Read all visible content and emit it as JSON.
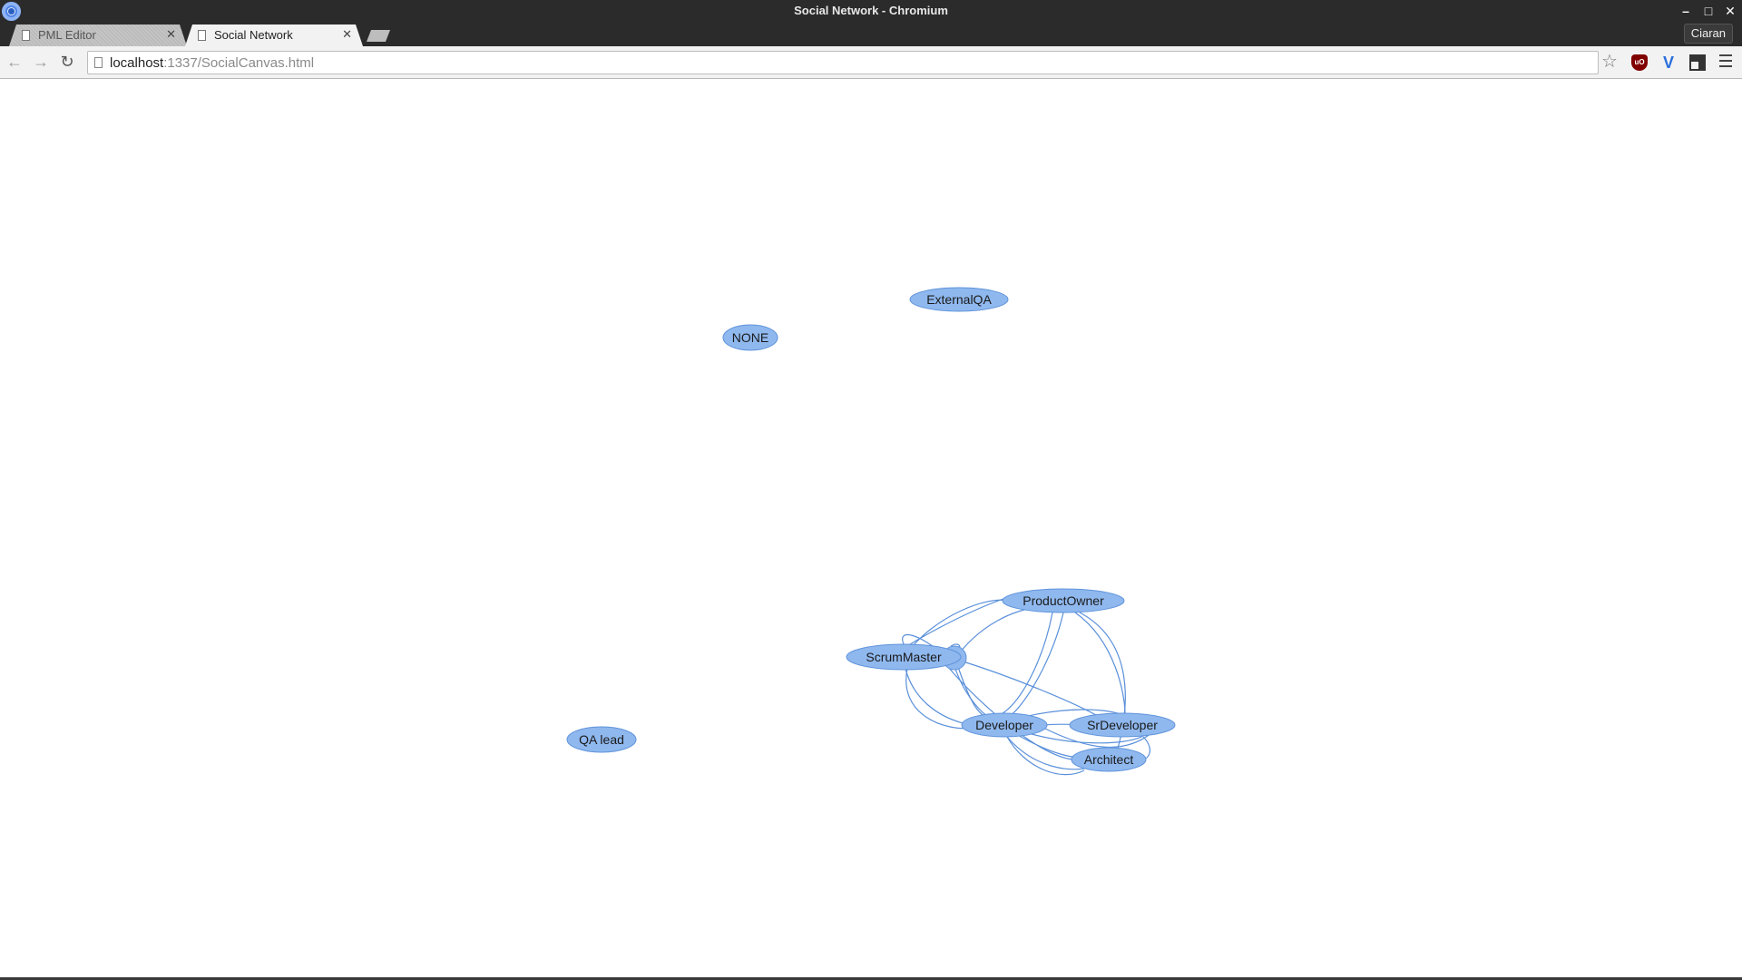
{
  "window": {
    "title": "Social Network - Chromium",
    "controls": {
      "minimize": "–",
      "maximize": "□",
      "close": "✕"
    }
  },
  "tabs": [
    {
      "label": "PML Editor",
      "active": false,
      "icon": "page-icon"
    },
    {
      "label": "Social Network",
      "active": true,
      "icon": "page-icon"
    }
  ],
  "profile": {
    "name": "Ciaran"
  },
  "toolbar": {
    "url_host": "localhost",
    "url_rest": ":1337/SocialCanvas.html",
    "back": "←",
    "forward": "→",
    "reload": "↻",
    "star": "☆",
    "extensions": [
      "ublock-origin-icon",
      "vimium-icon",
      "tab-grid-icon"
    ]
  },
  "graph": {
    "node_color": "#8fb8ee",
    "node_stroke": "#5f93db",
    "edge_color": "#5a90da",
    "nodes": [
      {
        "id": "ExternalQA",
        "label": "ExternalQA"
      },
      {
        "id": "NONE",
        "label": "NONE"
      },
      {
        "id": "ProductOwner",
        "label": "ProductOwner"
      },
      {
        "id": "ScrumMaster",
        "label": "ScrumMaster"
      },
      {
        "id": "Developer",
        "label": "Developer"
      },
      {
        "id": "SrDeveloper",
        "label": "SrDeveloper"
      },
      {
        "id": "Architect",
        "label": "Architect"
      },
      {
        "id": "QAlead",
        "label": "QA lead"
      }
    ]
  }
}
